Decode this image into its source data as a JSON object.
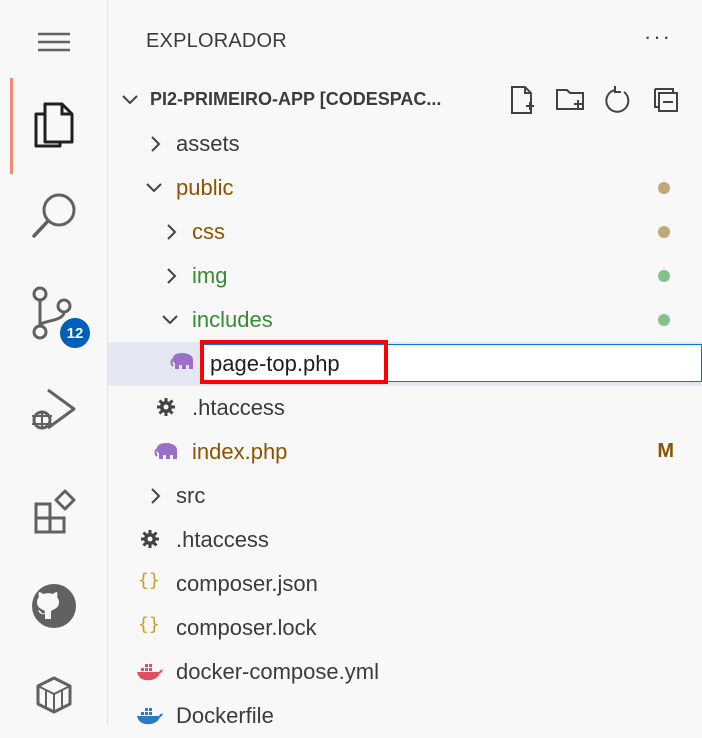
{
  "activity_bar": {
    "items": [
      {
        "name": "menu",
        "icon": "hamburger-menu-icon"
      },
      {
        "name": "explorer",
        "icon": "files-icon",
        "active": true
      },
      {
        "name": "search",
        "icon": "search-icon"
      },
      {
        "name": "source-control",
        "icon": "source-control-icon",
        "badge": "12"
      },
      {
        "name": "run-debug",
        "icon": "run-debug-icon"
      },
      {
        "name": "extensions",
        "icon": "extensions-icon"
      },
      {
        "name": "github",
        "icon": "github-icon"
      },
      {
        "name": "remote-explorer",
        "icon": "remote-explorer-icon"
      }
    ]
  },
  "sidebar": {
    "title": "EXPLORADOR",
    "more": "···",
    "root": {
      "title": "PI2-PRIMEIRO-APP [CODESPAC...",
      "actions": [
        "new-file-icon",
        "new-folder-icon",
        "refresh-icon",
        "collapse-all-icon"
      ]
    },
    "tree": [
      {
        "label": "assets",
        "type": "folder",
        "expanded": false,
        "depth": 1
      },
      {
        "label": "public",
        "type": "folder",
        "expanded": true,
        "depth": 1,
        "status_dot": "#c2a77b"
      },
      {
        "label": "css",
        "type": "folder",
        "expanded": false,
        "depth": 2,
        "status_dot": "#c2a77b"
      },
      {
        "label": "img",
        "type": "folder",
        "expanded": false,
        "depth": 2,
        "status_dot": "#84c28d"
      },
      {
        "label": "includes",
        "type": "folder",
        "expanded": true,
        "depth": 2,
        "status_dot": "#84c28d"
      },
      {
        "label": "page-top.php",
        "type": "php-file",
        "editing": true,
        "depth": 3
      },
      {
        "label": ".htaccess",
        "type": "config-file",
        "depth": 2
      },
      {
        "label": "index.php",
        "type": "php-file",
        "depth": 2,
        "status_mark": "M"
      },
      {
        "label": "src",
        "type": "folder",
        "expanded": false,
        "depth": 1
      },
      {
        "label": ".htaccess",
        "type": "config-file",
        "depth": 1
      },
      {
        "label": "composer.json",
        "type": "json-file",
        "depth": 1
      },
      {
        "label": "composer.lock",
        "type": "json-file",
        "depth": 1
      },
      {
        "label": "docker-compose.yml",
        "type": "docker-file",
        "depth": 1
      },
      {
        "label": "Dockerfile",
        "type": "docker-file",
        "depth": 1
      }
    ]
  },
  "colors": {
    "accent": "#005fb8",
    "modified": "#895503",
    "untracked": "#388a34",
    "highlight_box": "#ff0000"
  }
}
